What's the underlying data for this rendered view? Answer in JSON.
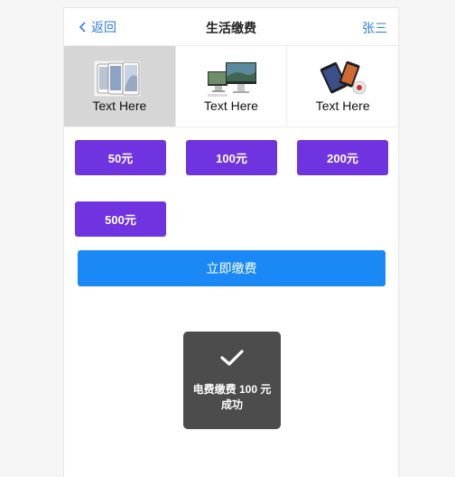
{
  "navbar": {
    "back_label": "返回",
    "title": "生活缴费",
    "user_name": "张三"
  },
  "products": [
    {
      "label": "Text Here",
      "icon": "phone-image-icon",
      "selected": true
    },
    {
      "label": "Text Here",
      "icon": "desktop-image-icon",
      "selected": false
    },
    {
      "label": "Text Here",
      "icon": "tablet-image-icon",
      "selected": false
    }
  ],
  "amounts": [
    "50元",
    "100元",
    "200元",
    "500元"
  ],
  "pay_button_label": "立即缴费",
  "toast": {
    "icon": "checkmark-icon",
    "message": "电费缴费 100 元成功"
  },
  "colors": {
    "accent_link": "#2b7ee0",
    "amount_button": "#7033e0",
    "pay_button": "#1a89f6",
    "toast_bg": "#4c4c4c",
    "selected_bg": "#d6d6d6"
  }
}
